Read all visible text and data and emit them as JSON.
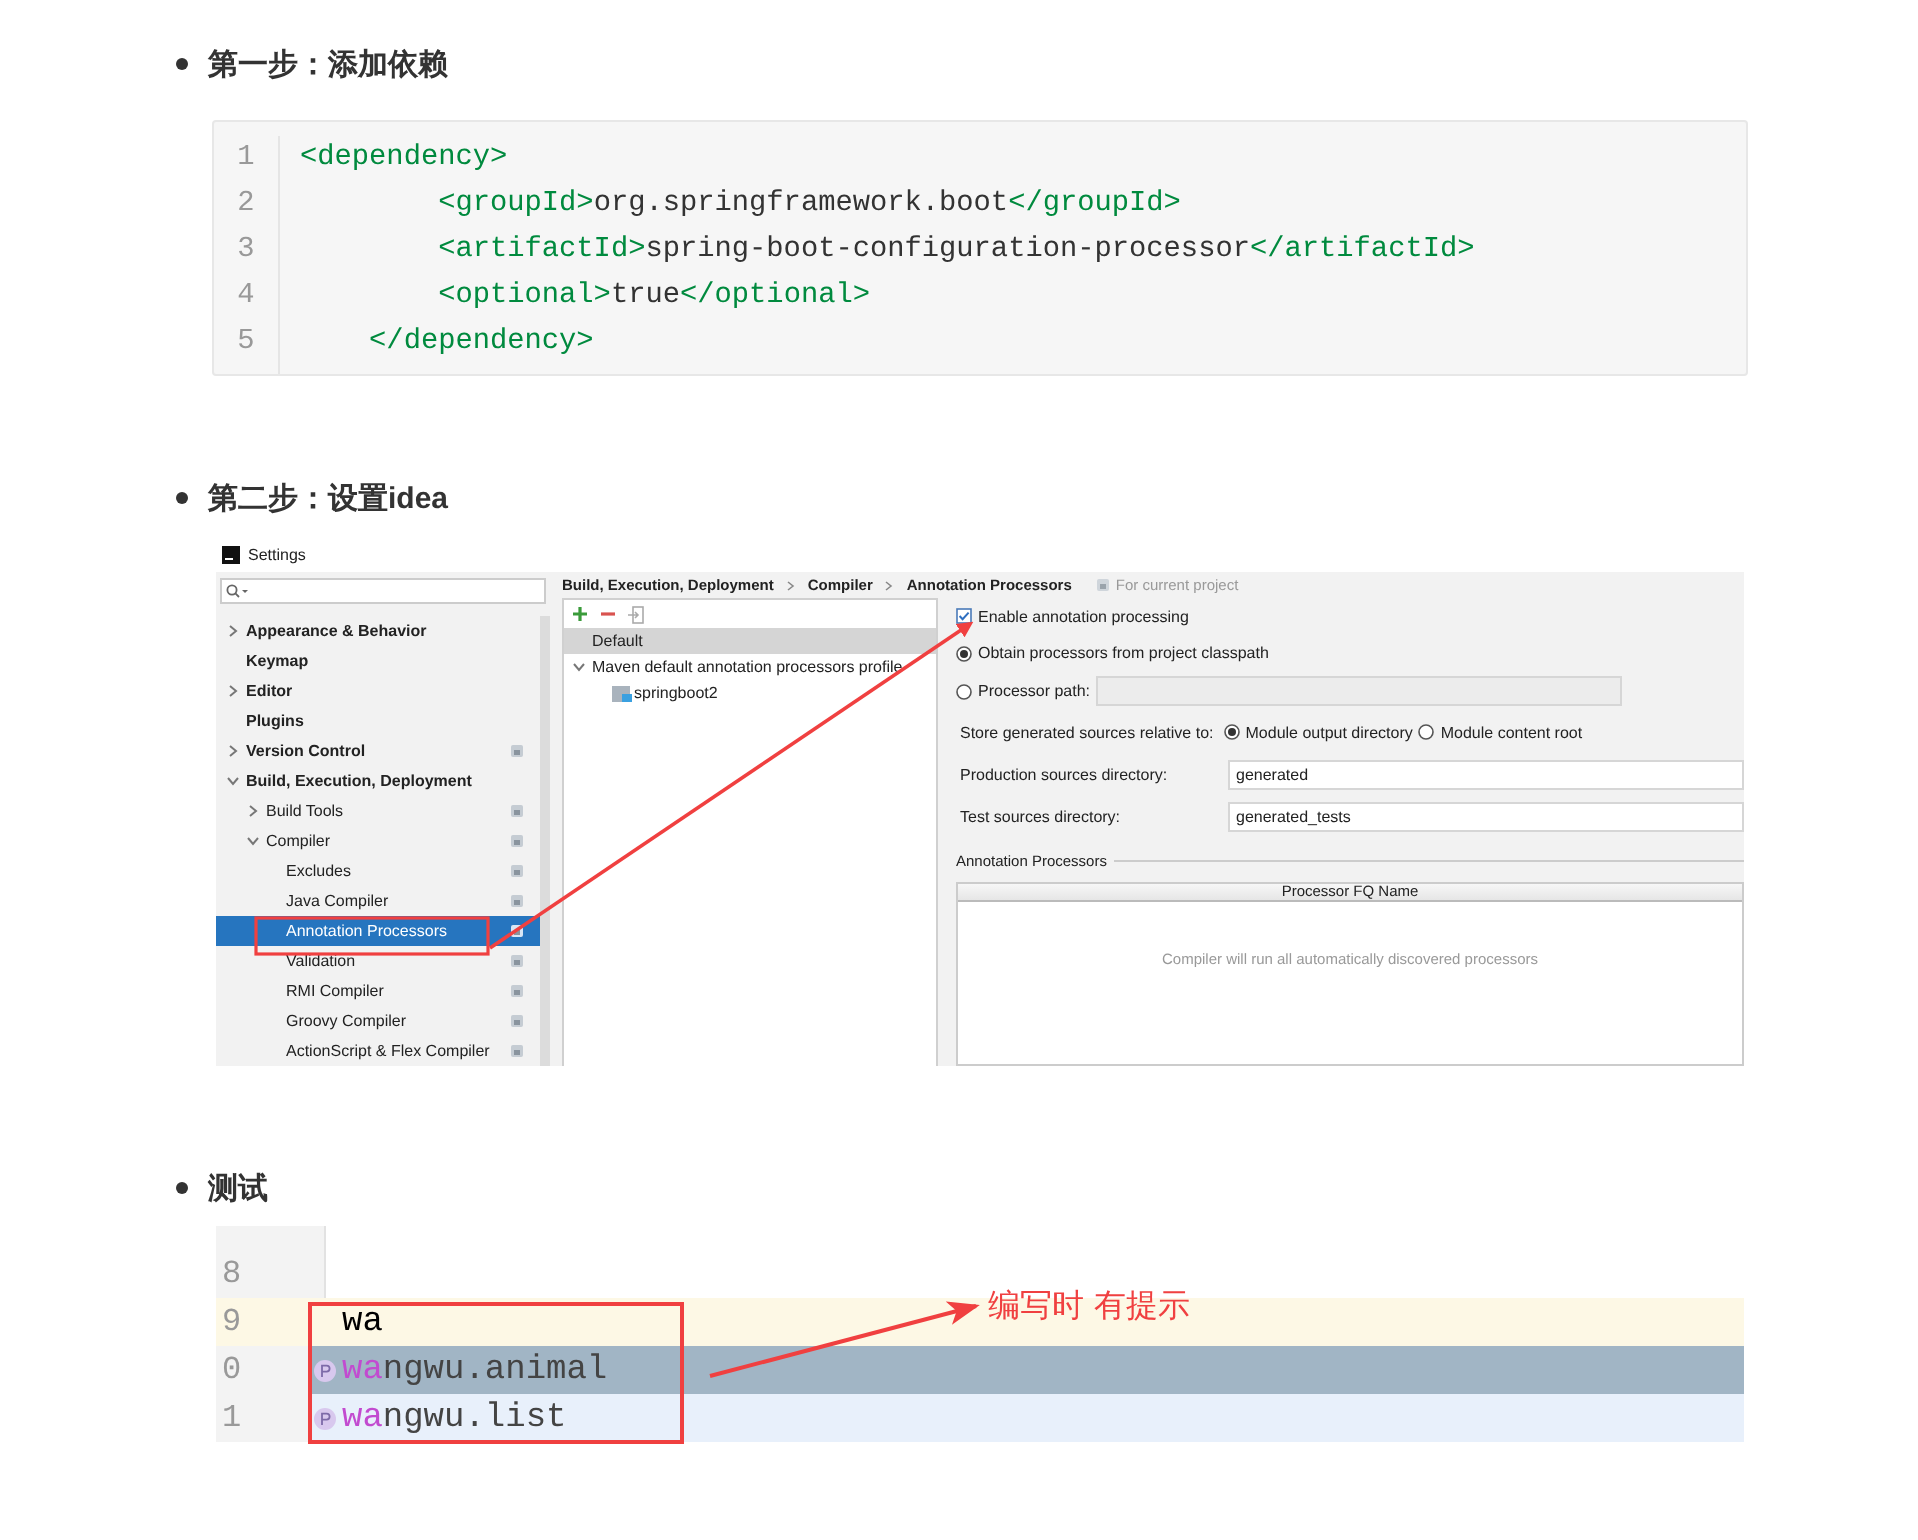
{
  "sections": [
    {
      "kind": "code",
      "heading": "第一步：添加依赖",
      "code": {
        "lines": [
          {
            "number": "1",
            "tokens": [
              {
                "kind": "tag",
                "text": "<dependency>"
              }
            ]
          },
          {
            "number": "2",
            "tokens": [
              {
                "kind": "tag",
                "text": "        <groupId>"
              },
              {
                "kind": "text",
                "text": "org.springframework.boot"
              },
              {
                "kind": "tag",
                "text": "</groupId>"
              }
            ]
          },
          {
            "number": "3",
            "tokens": [
              {
                "kind": "tag",
                "text": "        <artifactId>"
              },
              {
                "kind": "text",
                "text": "spring-boot-configuration-processor"
              },
              {
                "kind": "tag",
                "text": "</artifactId>"
              }
            ]
          },
          {
            "number": "4",
            "tokens": [
              {
                "kind": "tag",
                "text": "        <optional>"
              },
              {
                "kind": "text",
                "text": "true"
              },
              {
                "kind": "tag",
                "text": "</optional>"
              }
            ]
          },
          {
            "number": "5",
            "tokens": [
              {
                "kind": "tag",
                "text": "    </dependency>"
              }
            ]
          }
        ]
      }
    },
    {
      "kind": "settings",
      "heading": "第二步：设置idea",
      "settings": {
        "window_title": "Settings",
        "tree": [
          {
            "label": "Appearance & Behavior",
            "expanded": false,
            "selected": false,
            "project_level": false
          },
          {
            "label": "Keymap",
            "selected": false,
            "project_level": false
          },
          {
            "label": "Editor",
            "expanded": false,
            "selected": false,
            "project_level": false
          },
          {
            "label": "Plugins",
            "selected": false,
            "project_level": false
          },
          {
            "label": "Version Control",
            "expanded": false,
            "selected": false,
            "project_level": true
          },
          {
            "label": "Build, Execution, Deployment",
            "expanded": true,
            "selected": false,
            "project_level": false,
            "children": [
              {
                "label": "Build Tools",
                "expanded": false,
                "selected": false,
                "project_level": true
              },
              {
                "label": "Compiler",
                "expanded": true,
                "selected": false,
                "project_level": true,
                "children": [
                  {
                    "label": "Excludes",
                    "selected": false,
                    "project_level": true
                  },
                  {
                    "label": "Java Compiler",
                    "selected": false,
                    "project_level": true
                  },
                  {
                    "label": "Annotation Processors",
                    "selected": true,
                    "project_level": true
                  },
                  {
                    "label": "Validation",
                    "selected": false,
                    "project_level": true
                  },
                  {
                    "label": "RMI Compiler",
                    "selected": false,
                    "project_level": true
                  },
                  {
                    "label": "Groovy Compiler",
                    "selected": false,
                    "project_level": true
                  },
                  {
                    "label": "ActionScript & Flex Compiler",
                    "selected": false,
                    "project_level": true
                  }
                ]
              }
            ]
          }
        ],
        "breadcrumb": [
          "Build, Execution, Deployment",
          "Compiler",
          "Annotation Processors"
        ],
        "scope_note": "For current project",
        "profiles": [
          {
            "label": "Default",
            "selected": true
          },
          {
            "label": "Maven default annotation processors profile",
            "selected": false,
            "expanded": true,
            "children": [
              {
                "label": "springboot2",
                "selected": false
              }
            ]
          }
        ],
        "enable": {
          "label": "Enable annotation processing",
          "checked": true
        },
        "sources": [
          {
            "label": "Obtain processors from project classpath",
            "selected": true
          },
          {
            "label": "Processor path:",
            "selected": false
          }
        ],
        "store_label": "Store generated sources relative to:",
        "store_options": [
          {
            "label": "Module output directory",
            "selected": true
          },
          {
            "label": "Module content root",
            "selected": false
          }
        ],
        "fields": [
          {
            "label": "Production sources directory:",
            "value": "generated"
          },
          {
            "label": "Test sources directory:",
            "value": "generated_tests"
          }
        ],
        "group_title": "Annotation Processors",
        "column": "Processor FQ Name",
        "empty_text": "Compiler will run all automatically discovered processors"
      }
    },
    {
      "kind": "editor",
      "heading": "测试",
      "editor": {
        "lines": [
          {
            "number": "8",
            "current": false
          },
          {
            "number": "9",
            "text": "wa",
            "current": true
          }
        ],
        "completions": [
          {
            "number": "0",
            "match": "wa",
            "rest": "ngwu.animal",
            "selected": true
          },
          {
            "number": "1",
            "match": "wa",
            "rest": "ngwu.list",
            "selected": false
          }
        ],
        "callout": "编写时 有提示"
      }
    }
  ]
}
